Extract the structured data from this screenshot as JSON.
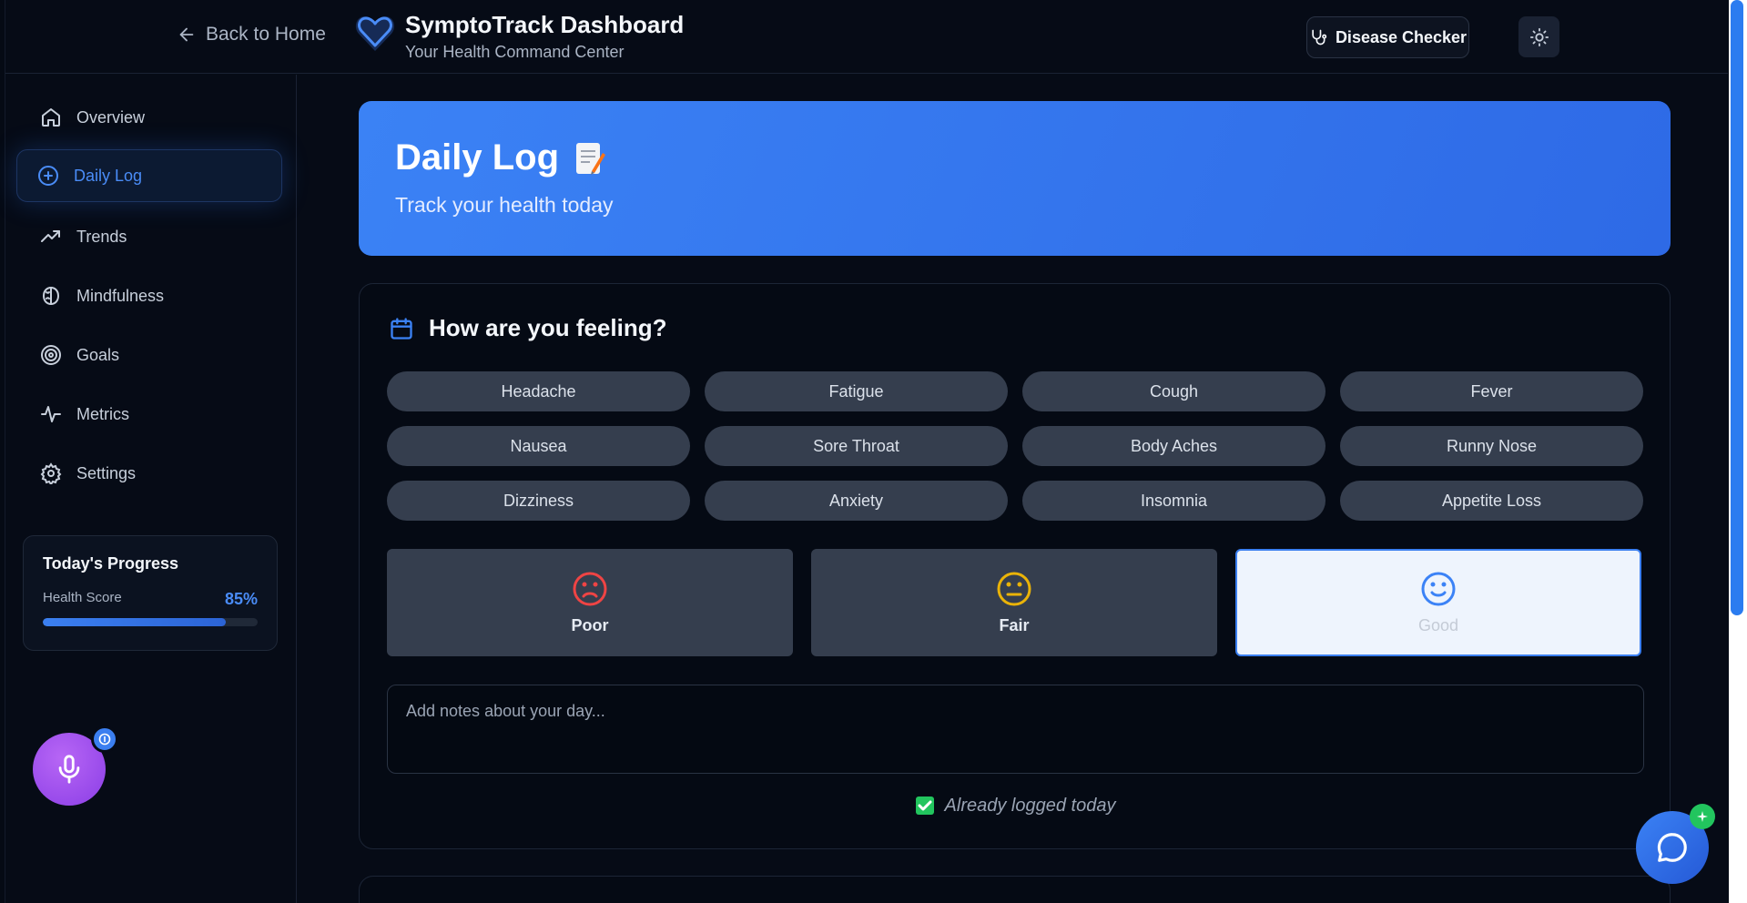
{
  "header": {
    "back_label": "Back to Home",
    "title": "SymptoTrack Dashboard",
    "subtitle": "Your Health Command Center",
    "disease_checker_label": "Disease Checker"
  },
  "sidebar": {
    "items": [
      {
        "label": "Overview",
        "icon": "home-icon"
      },
      {
        "label": "Daily Log",
        "icon": "plus-circle-icon",
        "active": true
      },
      {
        "label": "Trends",
        "icon": "trending-up-icon"
      },
      {
        "label": "Mindfulness",
        "icon": "brain-icon"
      },
      {
        "label": "Goals",
        "icon": "target-icon"
      },
      {
        "label": "Metrics",
        "icon": "activity-icon"
      },
      {
        "label": "Settings",
        "icon": "gear-icon"
      }
    ],
    "progress": {
      "title": "Today's Progress",
      "label": "Health Score",
      "value": "85%",
      "fraction": 0.85
    }
  },
  "hero": {
    "title": "Daily Log",
    "subtitle": "Track your health today"
  },
  "log": {
    "title": "How are you feeling?",
    "symptoms": [
      "Headache",
      "Fatigue",
      "Cough",
      "Fever",
      "Nausea",
      "Sore Throat",
      "Body Aches",
      "Runny Nose",
      "Dizziness",
      "Anxiety",
      "Insomnia",
      "Appetite Loss"
    ],
    "moods": [
      {
        "label": "Poor",
        "color": "#ef4444"
      },
      {
        "label": "Fair",
        "color": "#eab308"
      },
      {
        "label": "Good",
        "color": "#3b82f6",
        "selected": true
      }
    ],
    "notes_placeholder": "Add notes about your day...",
    "logged_text": "Already logged today"
  },
  "colors": {
    "accent": "#3b82f5",
    "background": "#060b16",
    "mic": "#a855f7",
    "success": "#22c55e"
  }
}
